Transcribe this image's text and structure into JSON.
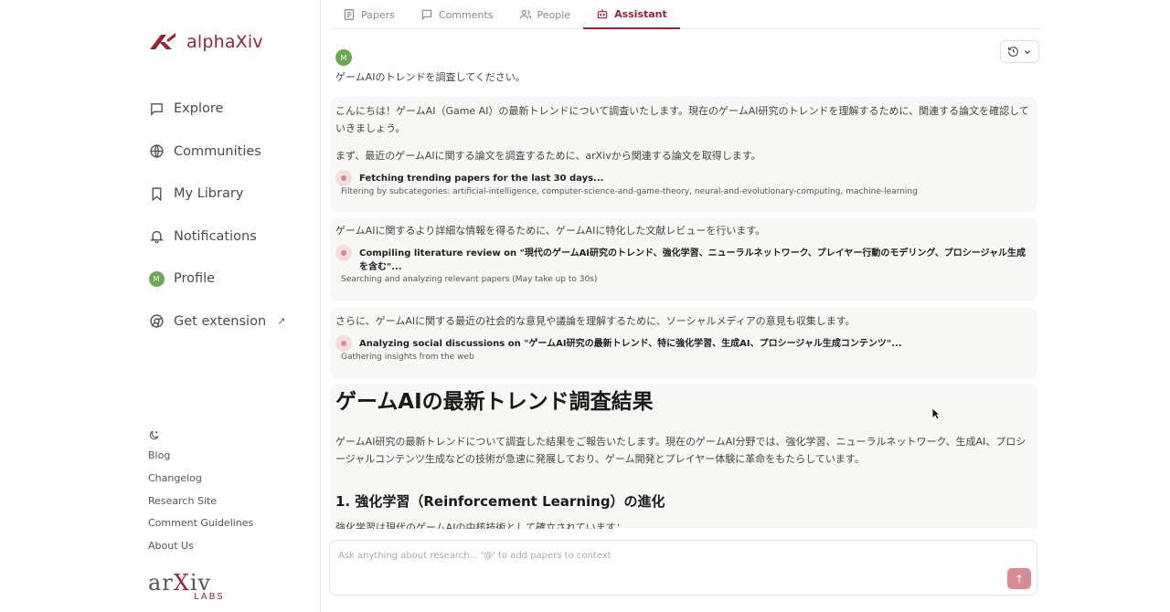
{
  "app": {
    "name": "alphaXiv"
  },
  "sidebar": {
    "items": [
      {
        "label": "Explore",
        "icon": "chat-bubble-icon"
      },
      {
        "label": "Communities",
        "icon": "globe-icon"
      },
      {
        "label": "My Library",
        "icon": "bookmark-icon"
      },
      {
        "label": "Notifications",
        "icon": "bell-icon"
      },
      {
        "label": "Profile",
        "icon": "avatar",
        "avatar_letter": "M"
      },
      {
        "label": "Get extension",
        "icon": "chrome-icon"
      }
    ],
    "footer_links": [
      "Blog",
      "Changelog",
      "Research Site",
      "Comment Guidelines",
      "About Us"
    ],
    "labs_logo": {
      "word_left": "ar",
      "word_x": "X",
      "word_right": "iv",
      "labs": "LABS"
    }
  },
  "tabs": [
    {
      "label": "Papers",
      "icon": "papers-icon",
      "active": false
    },
    {
      "label": "Comments",
      "icon": "comment-icon",
      "active": false
    },
    {
      "label": "People",
      "icon": "people-icon",
      "active": false
    },
    {
      "label": "Assistant",
      "icon": "robot-icon",
      "active": true
    }
  ],
  "chat": {
    "user": {
      "avatar_letter": "M",
      "message": "ゲームAIのトレンドを調査してください。"
    },
    "bubble1": {
      "text1": "こんにちは！ゲームAI（Game AI）の最新トレンドについて調査いたします。現在のゲームAI研究のトレンドを理解するために、関連する論文を確認していきましょう。",
      "text2": "まず、最近のゲームAIに関する論文を調査するために、arXivから関連する論文を取得します。",
      "step_title": "Fetching trending papers for the last 30 days...",
      "step_sub": "Filtering by subcategories: artificial-intelligence, computer-science-and-game-theory, neural-and-evolutionary-computing, machine-learning"
    },
    "bubble2": {
      "text": "ゲームAIに関するより詳細な情報を得るために、ゲームAIに特化した文献レビューを行います。",
      "step_title": "Compiling literature review on \"現代のゲームAI研究のトレンド、強化学習、ニューラルネットワーク、プレイヤー行動のモデリング、プロシージャル生成を含む\"...",
      "step_sub": "Searching and analyzing relevant papers (May take up to 30s)"
    },
    "bubble3": {
      "text": "さらに、ゲームAIに関する最近の社会的な意見や議論を理解するために、ソーシャルメディアの意見も収集します。",
      "step_title": "Analyzing social discussions on \"ゲームAI研究の最新トレンド、特に強化学習、生成AI、プロシージャル生成コンテンツ\"...",
      "step_sub": "Gathering insights from the web"
    },
    "report": {
      "title": "ゲームAIの最新トレンド調査結果",
      "intro": "ゲームAI研究の最新トレンドについて調査した結果をご報告いたします。現在のゲームAI分野では、強化学習、ニューラルネットワーク、生成AI、プロシージャルコンテンツ生成などの技術が急速に発展しており、ゲーム開発とプレイヤー体験に革命をもたらしています。",
      "section1": "1. 強化学習（Reinforcement Learning）の進化",
      "section1_text": "強化学習は現代のゲームAIの中核技術として確立されています："
    }
  },
  "input": {
    "placeholder": "Ask anything about research... '@' to add papers to context",
    "send_icon": "arrow-up-icon"
  },
  "colors": {
    "accent": "#9b2335",
    "send_button": "#d98a93",
    "avatar": "#6aa84f"
  }
}
